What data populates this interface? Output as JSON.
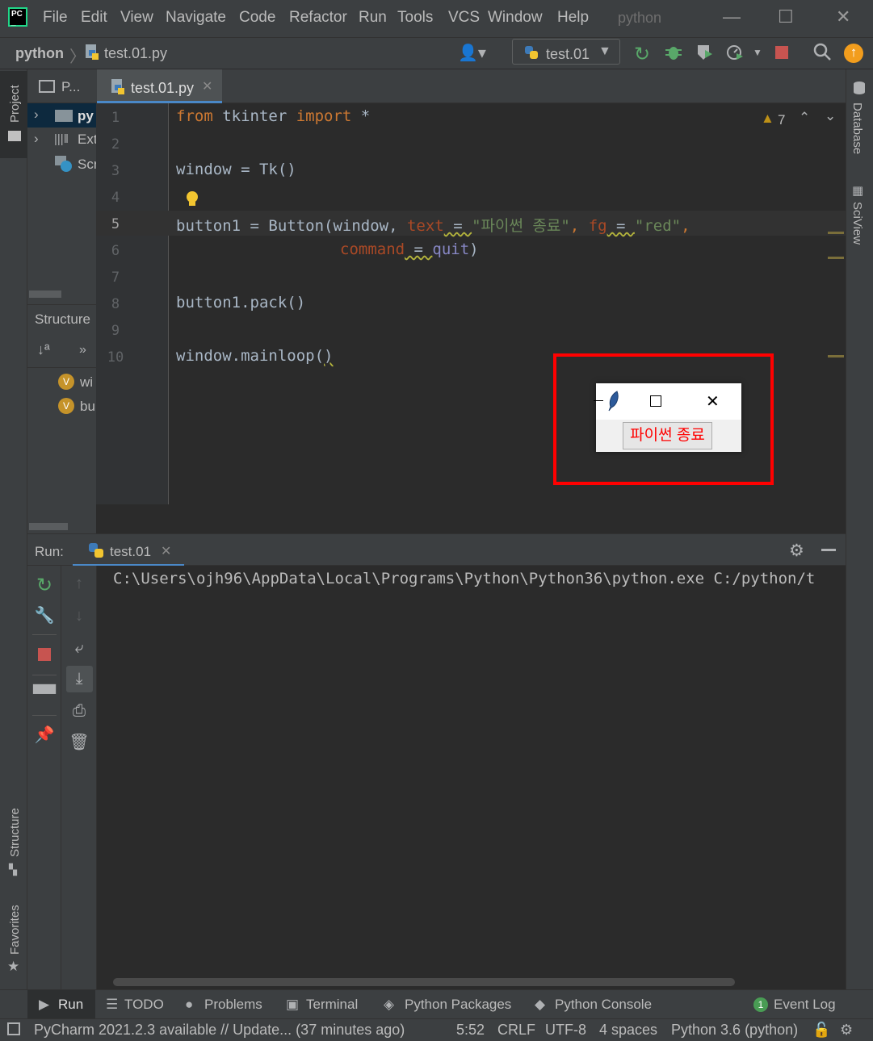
{
  "menubar": {
    "items": [
      "File",
      "Edit",
      "View",
      "Navigate",
      "Code",
      "Refactor",
      "Run",
      "Tools",
      "VCS",
      "Window",
      "Help"
    ],
    "project_title": "python"
  },
  "navbar": {
    "breadcrumb_project": "python",
    "breadcrumb_file": "test.01.py",
    "run_config": "test.01"
  },
  "left_stripe": {
    "project": "Project",
    "structure": "Structure",
    "favorites": "Favorites"
  },
  "right_stripe": {
    "database": "Database",
    "sciview": "SciView"
  },
  "project_panel": {
    "header": "P...",
    "tree": [
      {
        "label": "py",
        "icon": "folder-icon"
      },
      {
        "label": "Ext",
        "icon": "library-icon"
      },
      {
        "label": "Scr",
        "icon": "scratches-icon"
      }
    ],
    "structure_title": "Structure",
    "structure_items": [
      {
        "badge": "V",
        "label": "wi"
      },
      {
        "badge": "V",
        "label": "bu"
      }
    ]
  },
  "editor": {
    "tab_label": "test.01.py",
    "warning_count": "7",
    "line_numbers": [
      "1",
      "2",
      "3",
      "4",
      "5",
      "6",
      "7",
      "8",
      "9",
      "10"
    ],
    "lines": {
      "l1_from": "from",
      "l1_mod": " tkinter ",
      "l1_import": "import",
      "l1_star": " *",
      "l3": "window = Tk()",
      "l5_a": "button1 = Button(window, ",
      "l5_text": "text",
      "l5_eq1": " = ",
      "l5_str1": "\"파이썬 종료\"",
      "l5_comma": ", ",
      "l5_fg": "fg",
      "l5_eq2": " = ",
      "l5_str2": "\"red\"",
      "l5_end": ",",
      "l6_cmd": "command",
      "l6_eq": " = ",
      "l6_quit": "quit",
      "l6_end": ")",
      "l8": "button1.pack()",
      "l10_a": "window.mainloop(",
      "l10_b": ")"
    }
  },
  "tk_window": {
    "button_label": "파이썬 종료",
    "button_color": "#ff0000"
  },
  "run_panel": {
    "label": "Run:",
    "tab_label": "test.01",
    "console_line": "C:\\Users\\ojh96\\AppData\\Local\\Programs\\Python\\Python36\\python.exe C:/python/t"
  },
  "bottom_tools": {
    "run": "Run",
    "todo": "TODO",
    "problems": "Problems",
    "terminal": "Terminal",
    "python_packages": "Python Packages",
    "python_console": "Python Console",
    "event_log_count": "1",
    "event_log": "Event Log"
  },
  "status_bar": {
    "message": "PyCharm 2021.2.3 available // Update... (37 minutes ago)",
    "position": "5:52",
    "line_sep": "CRLF",
    "encoding": "UTF-8",
    "indent": "4 spaces",
    "interpreter": "Python 3.6 (python)"
  },
  "colors": {
    "background": "#2b2b2b",
    "panel": "#3c3f41",
    "keyword": "#cc7832",
    "string": "#6a8759",
    "highlight_box": "#ff0000"
  }
}
